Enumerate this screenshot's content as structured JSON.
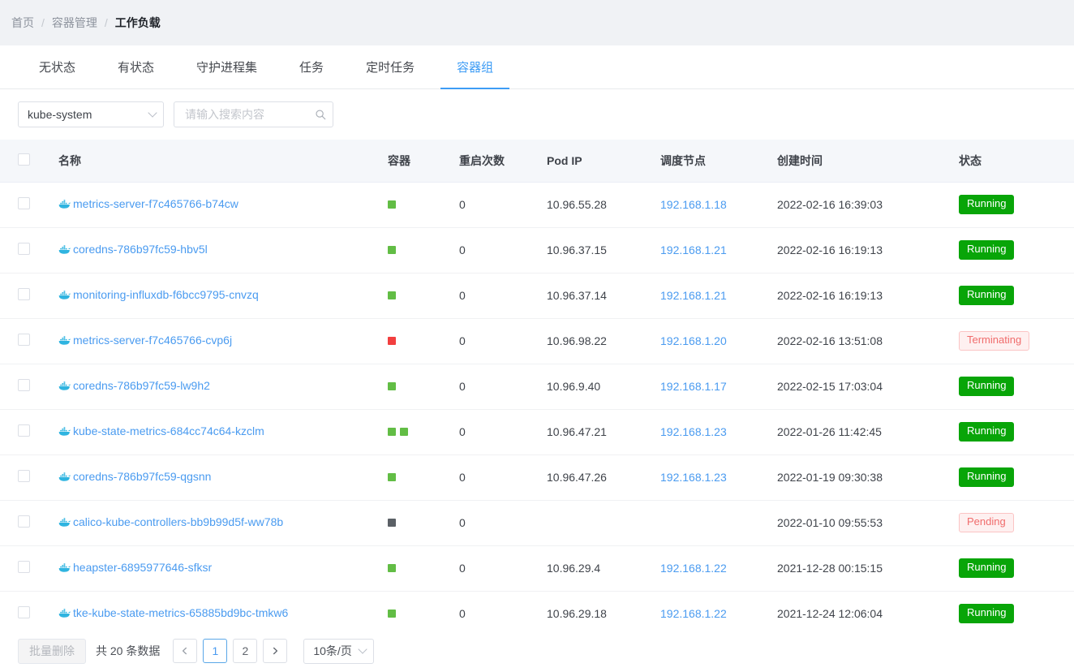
{
  "breadcrumb": {
    "items": [
      "首页",
      "容器管理",
      "工作负载"
    ],
    "separator": "/"
  },
  "tabs": [
    {
      "label": "无状态",
      "active": false
    },
    {
      "label": "有状态",
      "active": false
    },
    {
      "label": "守护进程集",
      "active": false
    },
    {
      "label": "任务",
      "active": false
    },
    {
      "label": "定时任务",
      "active": false
    },
    {
      "label": "容器组",
      "active": true
    }
  ],
  "filters": {
    "namespace_value": "kube-system",
    "search_placeholder": "请输入搜索内容",
    "search_value": "",
    "search_icon": "search-icon",
    "chevron_icon": "chevron-down-icon"
  },
  "table": {
    "columns": [
      "名称",
      "容器",
      "重启次数",
      "Pod IP",
      "调度节点",
      "创建时间",
      "状态"
    ],
    "rows": [
      {
        "name": "metrics-server-f7c465766-b74cw",
        "containers": [
          "green"
        ],
        "restarts": "0",
        "pod_ip": "10.96.55.28",
        "node": "192.168.1.18",
        "created": "2022-02-16 16:39:03",
        "status": "Running",
        "status_kind": "ok"
      },
      {
        "name": "coredns-786b97fc59-hbv5l",
        "containers": [
          "green"
        ],
        "restarts": "0",
        "pod_ip": "10.96.37.15",
        "node": "192.168.1.21",
        "created": "2022-02-16 16:19:13",
        "status": "Running",
        "status_kind": "ok"
      },
      {
        "name": "monitoring-influxdb-f6bcc9795-cnvzq",
        "containers": [
          "green"
        ],
        "restarts": "0",
        "pod_ip": "10.96.37.14",
        "node": "192.168.1.21",
        "created": "2022-02-16 16:19:13",
        "status": "Running",
        "status_kind": "ok"
      },
      {
        "name": "metrics-server-f7c465766-cvp6j",
        "containers": [
          "red"
        ],
        "restarts": "0",
        "pod_ip": "10.96.98.22",
        "node": "192.168.1.20",
        "created": "2022-02-16 13:51:08",
        "status": "Terminating",
        "status_kind": "warn"
      },
      {
        "name": "coredns-786b97fc59-lw9h2",
        "containers": [
          "green"
        ],
        "restarts": "0",
        "pod_ip": "10.96.9.40",
        "node": "192.168.1.17",
        "created": "2022-02-15 17:03:04",
        "status": "Running",
        "status_kind": "ok"
      },
      {
        "name": "kube-state-metrics-684cc74c64-kzclm",
        "containers": [
          "green",
          "green"
        ],
        "restarts": "0",
        "pod_ip": "10.96.47.21",
        "node": "192.168.1.23",
        "created": "2022-01-26 11:42:45",
        "status": "Running",
        "status_kind": "ok"
      },
      {
        "name": "coredns-786b97fc59-qgsnn",
        "containers": [
          "green"
        ],
        "restarts": "0",
        "pod_ip": "10.96.47.26",
        "node": "192.168.1.23",
        "created": "2022-01-19 09:30:38",
        "status": "Running",
        "status_kind": "ok"
      },
      {
        "name": "calico-kube-controllers-bb9b99d5f-ww78b",
        "containers": [
          "gray"
        ],
        "restarts": "0",
        "pod_ip": "",
        "node": "",
        "created": "2022-01-10 09:55:53",
        "status": "Pending",
        "status_kind": "warn"
      },
      {
        "name": "heapster-6895977646-sfksr",
        "containers": [
          "green"
        ],
        "restarts": "0",
        "pod_ip": "10.96.29.4",
        "node": "192.168.1.22",
        "created": "2021-12-28 00:15:15",
        "status": "Running",
        "status_kind": "ok"
      },
      {
        "name": "tke-kube-state-metrics-65885bd9bc-tmkw6",
        "containers": [
          "green"
        ],
        "restarts": "0",
        "pod_ip": "10.96.29.18",
        "node": "192.168.1.22",
        "created": "2021-12-24 12:06:04",
        "status": "Running",
        "status_kind": "ok"
      }
    ]
  },
  "footer": {
    "batch_delete_label": "批量删除",
    "total_text": "共 20 条数据",
    "prev_icon": "chevron-left-icon",
    "next_icon": "chevron-right-icon",
    "pages": [
      "1",
      "2"
    ],
    "current_page": "1",
    "page_size_label": "10条/页"
  },
  "colors": {
    "accent": "#3d9cf5",
    "link": "#4a9bf0",
    "status_ok": "#08a508",
    "status_warn_text": "#f06c6c",
    "status_warn_bg": "#fef0f0",
    "status_warn_border": "#fbc4c4",
    "container_green": "#62bd45",
    "container_red": "#f23f3f",
    "container_gray": "#5b6066"
  }
}
